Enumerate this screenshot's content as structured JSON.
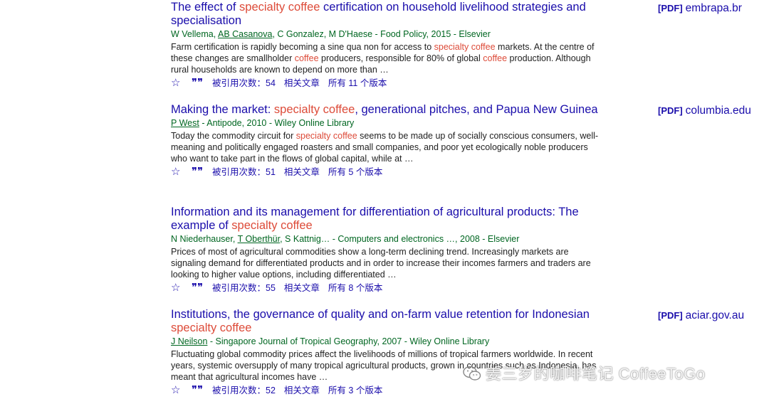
{
  "results": [
    {
      "title_parts": [
        "The effect of ",
        "specialty coffee",
        " certification on household livelihood strategies and specialisation"
      ],
      "authors_parts": [
        "W Vellema, ",
        "AB Casanova",
        ", C Gonzalez, M D'Haese - Food Policy, 2015 - Elsevier"
      ],
      "snippet_parts": [
        "Farm certification is rapidly becoming a sine qua non for access to ",
        "specialty coffee",
        " markets. At the centre of these changes are smallholder ",
        "coffee",
        " producers, responsible for 80% of global ",
        "coffee",
        " production. Although rural households are known to depend on more than …"
      ],
      "cite_count": "被引用次数：54",
      "related": "相关文章",
      "versions": "所有 11 个版本",
      "pdf_tag": "[PDF]",
      "pdf_domain": "embrapa.br"
    },
    {
      "title_parts": [
        "Making the market: ",
        "specialty coffee",
        ", generational pitches, and Papua New Guinea"
      ],
      "authors_parts": [
        "",
        "P West",
        " - Antipode, 2010 - Wiley Online Library"
      ],
      "snippet_parts": [
        "Today the commodity circuit for ",
        "specialty coffee",
        " seems to be made up of socially conscious consumers, well-meaning and politically engaged roasters and small companies, and poor yet ecologically noble producers who want to take part in the flows of global capital, while at …"
      ],
      "cite_count": "被引用次数：51",
      "related": "相关文章",
      "versions": "所有 5 个版本",
      "pdf_tag": "[PDF]",
      "pdf_domain": "columbia.edu"
    },
    {
      "title_parts": [
        "Information and its management for differentiation of agricultural products: The example of ",
        "specialty coffee",
        ""
      ],
      "authors_parts": [
        "N Niederhauser, ",
        "T Oberthür",
        ", S Kattnig… - Computers and electronics …, 2008 - Elsevier"
      ],
      "snippet_parts": [
        "Prices of most of agricultural commodities show a long-term declining trend. Increasingly markets are signaling demand for differentiated products and in order to increase their incomes farmers and traders are looking to higher value options, including differentiated …"
      ],
      "cite_count": "被引用次数：55",
      "related": "相关文章",
      "versions": "所有 8 个版本",
      "pdf_tag": "",
      "pdf_domain": ""
    },
    {
      "title_parts": [
        "Institutions, the governance of quality and on-farm value retention for Indonesian ",
        "specialty coffee",
        ""
      ],
      "authors_parts": [
        "",
        "J Neilson",
        " - Singapore Journal of Tropical Geography, 2007 - Wiley Online Library"
      ],
      "snippet_parts": [
        "Fluctuating global commodity prices affect the livelihoods of millions of tropical farmers worldwide. In recent years, systemic oversupply of many tropical agricultural products, grown in countries such as Indonesia, has meant that agricultural incomes have …"
      ],
      "cite_count": "被引用次数：52",
      "related": "相关文章",
      "versions": "所有 3 个版本",
      "pdf_tag": "[PDF]",
      "pdf_domain": "aciar.gov.au"
    }
  ],
  "icons": {
    "save": "star-outline-icon",
    "cite": "quote-icon"
  },
  "watermark": "姜三岁的咖啡笔记 CoffeeToGo",
  "colors": {
    "title": "#1a0dab",
    "highlight": "#dd4b39",
    "authors": "#006621",
    "snippet": "#222222"
  }
}
